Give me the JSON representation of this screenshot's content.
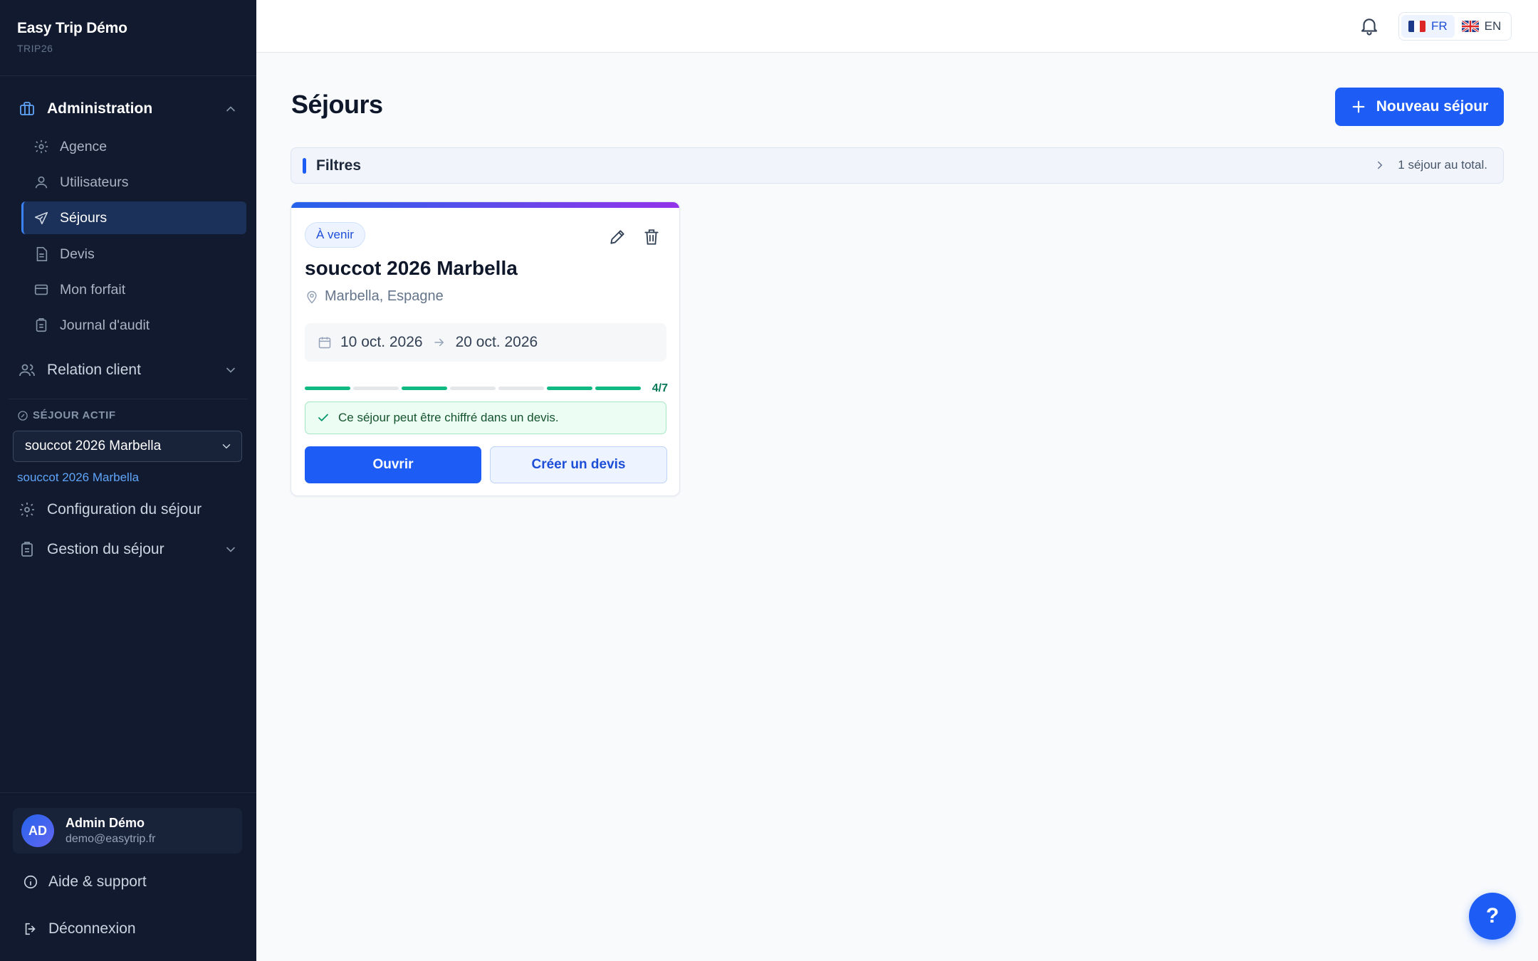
{
  "brand": {
    "name": "Easy Trip Démo",
    "code": "TRIP26"
  },
  "sidebar": {
    "administration": {
      "label": "Administration",
      "items": [
        {
          "label": "Agence",
          "icon": "gear-icon"
        },
        {
          "label": "Utilisateurs",
          "icon": "user-icon"
        },
        {
          "label": "Séjours",
          "icon": "plane-icon",
          "active": true
        },
        {
          "label": "Devis",
          "icon": "document-icon"
        },
        {
          "label": "Mon forfait",
          "icon": "credit-card-icon"
        },
        {
          "label": "Journal d'audit",
          "icon": "clipboard-icon"
        }
      ]
    },
    "relation_client": {
      "label": "Relation client"
    },
    "sejour_actif": {
      "label": "SÉJOUR ACTIF",
      "selected": "souccot 2026 Marbella",
      "link": "souccot 2026 Marbella"
    },
    "configuration": {
      "label": "Configuration du séjour"
    },
    "gestion": {
      "label": "Gestion du séjour"
    },
    "user": {
      "initials": "AD",
      "name": "Admin Démo",
      "email": "demo@easytrip.fr"
    },
    "help": {
      "label": "Aide & support"
    },
    "logout": {
      "label": "Déconnexion"
    }
  },
  "topbar": {
    "languages": [
      {
        "code": "FR",
        "active": true
      },
      {
        "code": "EN",
        "active": false
      }
    ]
  },
  "main": {
    "title": "Séjours",
    "new_button": "Nouveau séjour",
    "filters": {
      "title": "Filtres",
      "total": "1 séjour au total."
    },
    "cards": [
      {
        "status": "À venir",
        "title": "souccot 2026 Marbella",
        "location": "Marbella, Espagne",
        "start_date": "10 oct. 2026",
        "end_date": "20 oct. 2026",
        "progress": {
          "completed": [
            true,
            false,
            true,
            false,
            false,
            true,
            true
          ],
          "label": "4/7"
        },
        "message": "Ce séjour peut être chiffré dans un devis.",
        "open_label": "Ouvrir",
        "quote_label": "Créer un devis"
      }
    ]
  },
  "help_fab": "?",
  "colors": {
    "accent": "#1d5cf5",
    "sidebar_bg": "#111a2e",
    "success": "#10b981"
  }
}
